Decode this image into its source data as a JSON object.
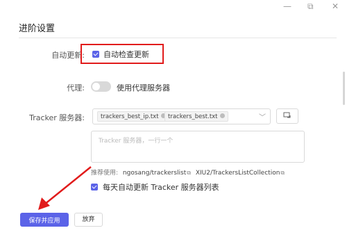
{
  "window": {
    "minimize_glyph": "—",
    "maximize_glyph": "⧉",
    "close_glyph": "✕"
  },
  "section": {
    "title": "进阶设置"
  },
  "auto_update": {
    "label": "自动更新:",
    "checked": true,
    "option_text": "自动检查更新"
  },
  "proxy": {
    "label": "代理:",
    "enabled": false,
    "option_text": "使用代理服务器"
  },
  "tracker": {
    "label": "Tracker 服务器:",
    "selected": [
      "trackers_best_ip.txt",
      "trackers_best.txt"
    ],
    "placeholder": "Tracker 服务器，一行一个",
    "recommend_label": "推荐使用:",
    "recommend_links": [
      "ngosang/trackerslist",
      "XIU2/TrackersListCollection"
    ],
    "daily_update_text": "每天自动更新 Tracker 服务器列表",
    "daily_update_checked": true
  },
  "actions": {
    "save_label": "保存并应用",
    "discard_label": "放弃"
  },
  "annotation_colors": {
    "highlight": "#e11b1b",
    "accent": "#5b63e8"
  }
}
